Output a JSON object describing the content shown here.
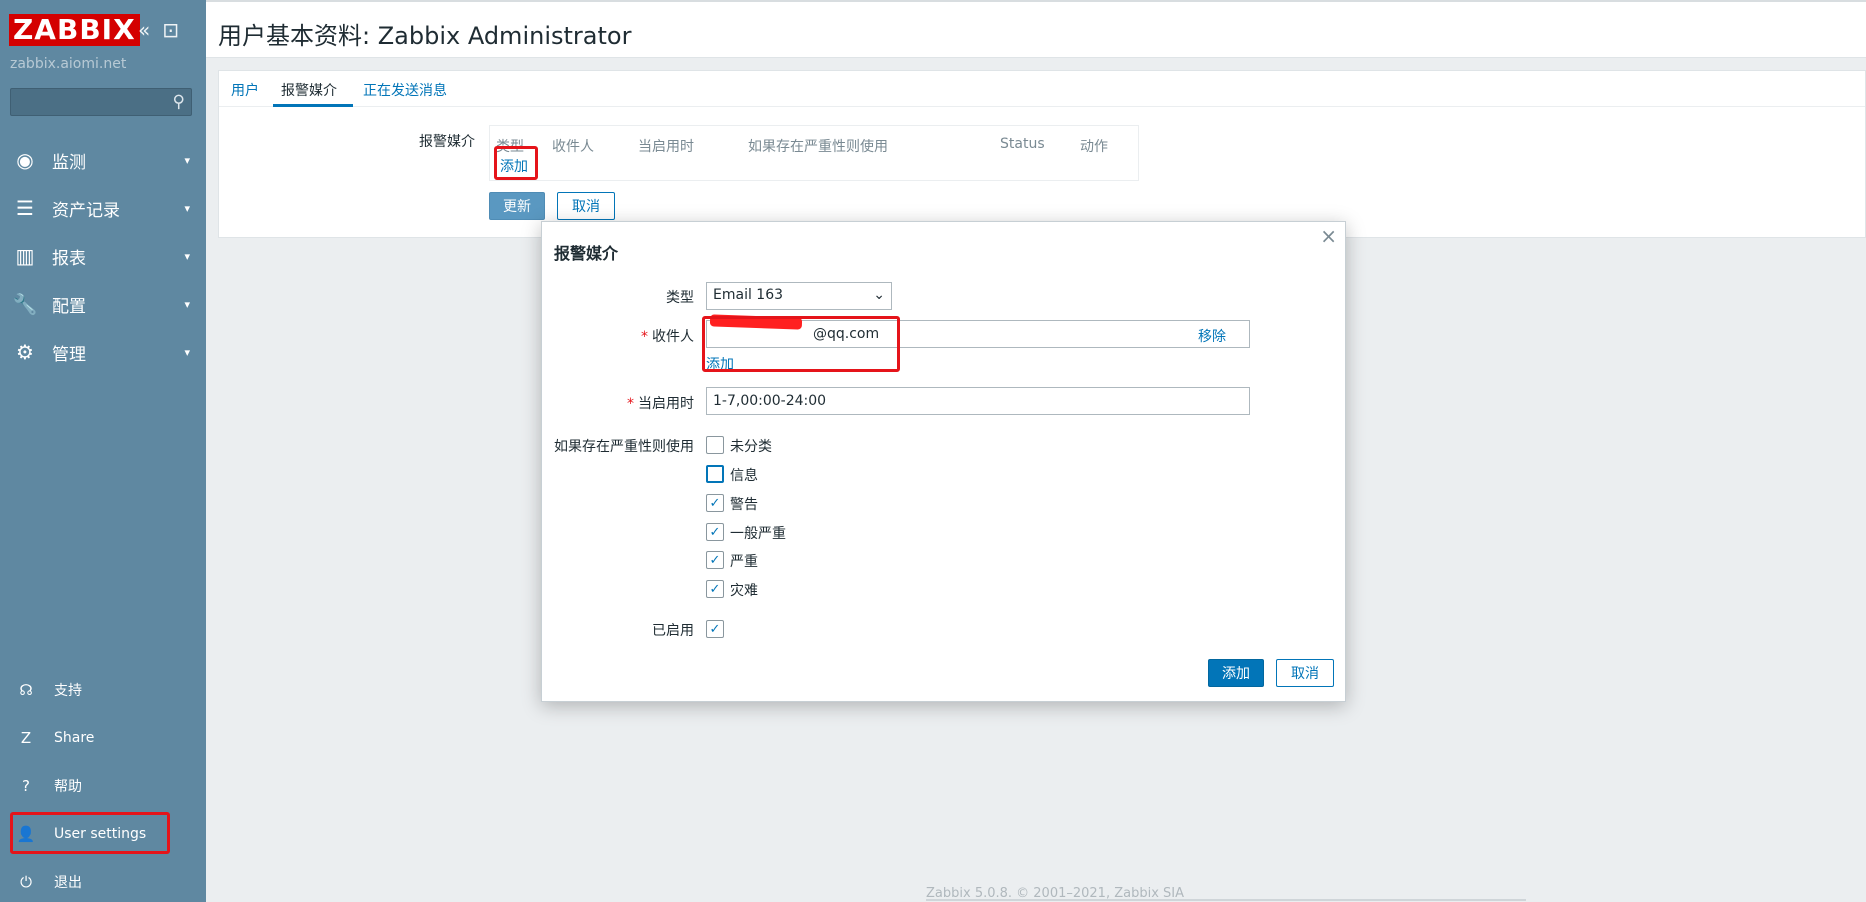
{
  "sidebar": {
    "logo": "ZABBIX",
    "server": "zabbix.aiomi.net",
    "search_placeholder": "",
    "menu": [
      {
        "label": "监测",
        "icon": "eye-icon",
        "glyph": "◉"
      },
      {
        "label": "资产记录",
        "icon": "list-icon",
        "glyph": "☰"
      },
      {
        "label": "报表",
        "icon": "bar-chart-icon",
        "glyph": "▥"
      },
      {
        "label": "配置",
        "icon": "wrench-icon",
        "glyph": "🔧"
      },
      {
        "label": "管理",
        "icon": "gear-icon",
        "glyph": "⚙"
      }
    ],
    "bottom": [
      {
        "label": "支持",
        "icon": "headset-icon",
        "glyph": "☊"
      },
      {
        "label": "Share",
        "icon": "share-z-icon",
        "glyph": "Z"
      },
      {
        "label": "帮助",
        "icon": "help-icon",
        "glyph": "?"
      },
      {
        "label": "User settings",
        "icon": "user-icon",
        "glyph": "👤"
      },
      {
        "label": "退出",
        "icon": "power-icon",
        "glyph": "⏻"
      }
    ]
  },
  "header": {
    "title": "用户基本资料: Zabbix Administrator"
  },
  "tabs": [
    "用户",
    "报警媒介",
    "正在发送消息"
  ],
  "media_section": {
    "label": "报警媒介",
    "columns": [
      "类型",
      "收件人",
      "当启用时",
      "如果存在严重性则使用",
      "Status",
      "动作"
    ],
    "add_link": "添加",
    "update_button": "更新",
    "cancel_button": "取消"
  },
  "modal": {
    "title": "报警媒介",
    "close": "×",
    "type_label": "类型",
    "type_value": "Email 163",
    "sendto_label": "收件人",
    "sendto_value": "@qq.com",
    "remove_link": "移除",
    "add_link": "添加",
    "when_active_label": "当启用时",
    "when_active_value": "1-7,00:00-24:00",
    "severity_label": "如果存在严重性则使用",
    "severities": [
      {
        "label": "未分类",
        "checked": false
      },
      {
        "label": "信息",
        "checked": false
      },
      {
        "label": "警告",
        "checked": true
      },
      {
        "label": "一般严重",
        "checked": true
      },
      {
        "label": "严重",
        "checked": true
      },
      {
        "label": "灾难",
        "checked": true
      }
    ],
    "enabled_label": "已启用",
    "enabled": true,
    "add_button": "添加",
    "cancel_button": "取消"
  },
  "footer": "Zabbix 5.0.8. © 2001–2021, Zabbix SIA",
  "colors": {
    "sidebar": "#5f88a1",
    "accent": "#0275b8",
    "highlight": "#e5141a"
  }
}
